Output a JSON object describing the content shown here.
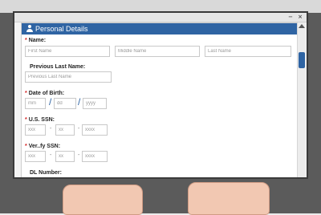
{
  "form": {
    "header_title": "Personal Details",
    "name_label": "Name:",
    "first_name_placeholder": "First Name",
    "middle_name_placeholder": "Middle Name",
    "last_name_placeholder": "Last Name",
    "previous_last_name_label": "Previous Last Name:",
    "previous_last_name_placeholder": "Previous Last Name",
    "dob_label": "Date of Birth:",
    "dob_mm_placeholder": "mm",
    "dob_dd_placeholder": "dd",
    "dob_yyyy_placeholder": "yyyy",
    "dob_separator": "/",
    "ssn_label": "U.S. SSN:",
    "ssn_part1_placeholder": "xxx",
    "ssn_part2_placeholder": "xx",
    "ssn_part3_placeholder": "xxxx",
    "ssn_dash": "-",
    "verify_ssn_label": "Ver..fy SSN:",
    "verify_part1_placeholder": "xxx",
    "verify_part2_placeholder": "xx",
    "verify_part3_placeholder": "xxxx",
    "dl_number_label": "DL Number:"
  },
  "window": {
    "minimize": "−",
    "close": "×"
  },
  "icons": {
    "header_icon": "person-icon",
    "scroll_up": "chevron-up-icon"
  },
  "colors": {
    "header_bg": "#2f64a3",
    "required_marker": "#d21d1d",
    "scroll_thumb": "#2f64a3"
  }
}
